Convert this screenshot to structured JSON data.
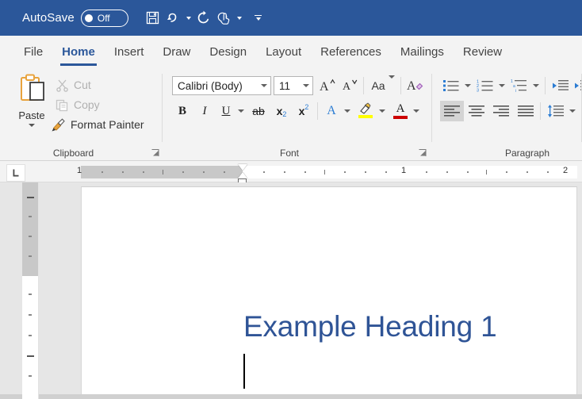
{
  "titlebar": {
    "autosave_label": "AutoSave",
    "autosave_state": "Off",
    "autosave_on": false,
    "accent_color": "#2b579a",
    "quick_access": [
      {
        "name": "save-icon",
        "tooltip": "Save",
        "has_caret": false
      },
      {
        "name": "undo-icon",
        "tooltip": "Undo",
        "has_caret": true
      },
      {
        "name": "redo-icon",
        "tooltip": "Repeat",
        "has_caret": false
      },
      {
        "name": "touch-mode-icon",
        "tooltip": "Touch/Mouse Mode",
        "has_caret": true
      }
    ],
    "customize_tooltip": "Customize Quick Access Toolbar"
  },
  "tabs": [
    {
      "label": "File",
      "active": false
    },
    {
      "label": "Home",
      "active": true
    },
    {
      "label": "Insert",
      "active": false
    },
    {
      "label": "Draw",
      "active": false
    },
    {
      "label": "Design",
      "active": false
    },
    {
      "label": "Layout",
      "active": false
    },
    {
      "label": "References",
      "active": false
    },
    {
      "label": "Mailings",
      "active": false
    },
    {
      "label": "Review",
      "active": false
    }
  ],
  "ribbon": {
    "groups": [
      {
        "label": "Clipboard",
        "has_launcher": true
      },
      {
        "label": "Font",
        "has_launcher": true
      },
      {
        "label": "Paragraph",
        "has_launcher": false
      }
    ],
    "clipboard": {
      "paste_label": "Paste",
      "cut_label": "Cut",
      "cut_enabled": false,
      "copy_label": "Copy",
      "copy_enabled": false,
      "format_painter_label": "Format Painter",
      "format_painter_enabled": true
    },
    "font": {
      "font_name": "Calibri (Body)",
      "font_size": "11",
      "grow_font_tooltip": "Increase Font Size",
      "shrink_font_tooltip": "Decrease Font Size",
      "change_case_label": "Aa",
      "clear_formatting_tooltip": "Clear All Formatting",
      "bold_label": "B",
      "italic_label": "I",
      "underline_label": "U",
      "strikethrough_label": "ab",
      "subscript_label": "x",
      "subscript_sub": "2",
      "superscript_label": "x",
      "superscript_sup": "2",
      "text_effects_label": "A",
      "text_effects_color": "#2b7cd3",
      "highlight_label": "A",
      "highlight_color": "#ffff00",
      "font_color_label": "A",
      "font_color": "#cc0000"
    },
    "paragraph": {
      "bullets_tooltip": "Bullets",
      "numbering_tooltip": "Numbering",
      "multilevel_tooltip": "Multilevel List",
      "decrease_indent_tooltip": "Decrease Indent",
      "increase_indent_tooltip": "Increase Indent",
      "align_left_tooltip": "Align Left",
      "align_center_tooltip": "Center",
      "align_right_tooltip": "Align Right",
      "justify_tooltip": "Justify",
      "line_spacing_tooltip": "Line and Paragraph Spacing",
      "active_alignment": "align-left",
      "icon_accent": "#2b7cd3"
    }
  },
  "ruler": {
    "tab_selector_tooltip": "Left Tab",
    "horizontal_numbers": [
      "1",
      "1",
      "2"
    ],
    "first_line_indent_tooltip": "First Line Indent",
    "hanging_indent_tooltip": "Hanging Indent",
    "left_indent_tooltip": "Left Indent"
  },
  "document": {
    "heading_text": "Example Heading 1",
    "heading_color": "#2f5496",
    "heading_style": "Heading 1",
    "page_background": "#ffffff",
    "workspace_background": "#e6e6e6",
    "cursor_visible": true
  }
}
